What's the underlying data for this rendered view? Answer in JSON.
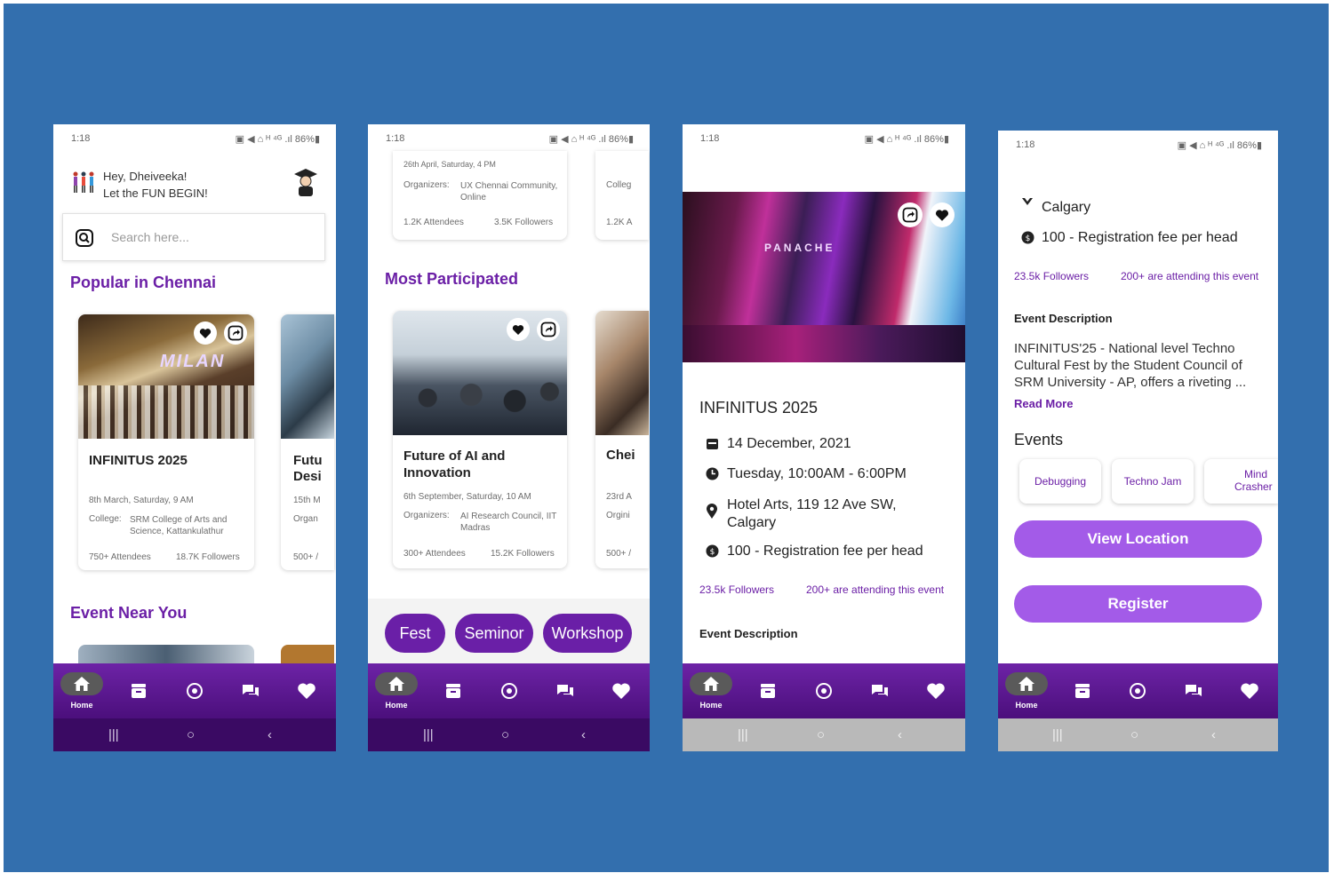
{
  "status": {
    "time": "1:18",
    "icons": "▣ ◀ ⌂ ᴴ ⁴ᴳ .ıl 86%▮",
    "battery": "86%"
  },
  "screen1": {
    "greeting": "Hey, Dheiveeka!",
    "subgreeting": "Let the FUN BEGIN!",
    "search_placeholder": "Search here...",
    "section_popular": "Popular in Chennai",
    "section_near": "Event Near You",
    "card1": {
      "image_text": "MILAN",
      "title": "INFINITUS 2025",
      "date": "8th March, Saturday,  9 AM",
      "college_label": "College:",
      "college": "SRM College of Arts and Science, Kattankulathur",
      "attendees": "750+ Attendees",
      "followers": "18.7K Followers"
    },
    "card2": {
      "title_a": "Futu",
      "title_b": "Desi",
      "date": "15th M",
      "org": "Organ",
      "attendees": "500+ /"
    }
  },
  "screen2": {
    "prev_card": {
      "date": "26th April, Saturday,  4 PM",
      "org_label": "Organizers:",
      "org": "UX Chennai Community, Online",
      "attendees": "1.2K Attendees",
      "followers": "3.5K Followers",
      "side_label": "Colleg",
      "side_attendees": "1.2K A"
    },
    "section": "Most Participated",
    "card1": {
      "title": "Future of AI and Innovation",
      "date": "6th September, Saturday,  10 AM",
      "org_label": "Organizers:",
      "org": "AI Research Council, IIT Madras",
      "attendees": "300+ Attendees",
      "followers": "15.2K Followers"
    },
    "card2": {
      "title": "Chei",
      "date": "23rd A",
      "org": "Orgini",
      "attendees": "500+ /"
    },
    "chips": [
      "Fest",
      "Seminor",
      "Workshop"
    ]
  },
  "screen3": {
    "title": "INFINITUS 2025",
    "banner_text": "PANACHE",
    "date": "14 December, 2021",
    "time": "Tuesday, 10:00AM - 6:00PM",
    "location": "Hotel Arts, 119 12 Ave SW, Calgary",
    "fee": "100 - Registration fee per head",
    "followers": "23.5k Followers",
    "attending": "200+ are attending this event",
    "desc_heading": "Event Description"
  },
  "screen4": {
    "location": "Calgary",
    "fee": "100 - Registration fee per head",
    "followers": "23.5k Followers",
    "attending": "200+ are attending this event",
    "desc_heading": "Event Description",
    "description": "INFINITUS'25 - National level Techno Cultural Fest by the Student Council of SRM University - AP, offers a riveting ...",
    "read_more": "Read More",
    "events_heading": "Events",
    "events": [
      "Debugging",
      "Techno Jam",
      "Mind Crasher"
    ],
    "view_location": "View Location",
    "register": "Register"
  },
  "nav": {
    "home_label": "Home",
    "items": [
      "home-icon",
      "tickets-icon",
      "add-icon",
      "chat-icon",
      "heart-icon"
    ]
  },
  "colors": {
    "background": "#336fae",
    "accent": "#6b1fa6",
    "navbar": "#5c1994",
    "button": "#a35be8"
  }
}
